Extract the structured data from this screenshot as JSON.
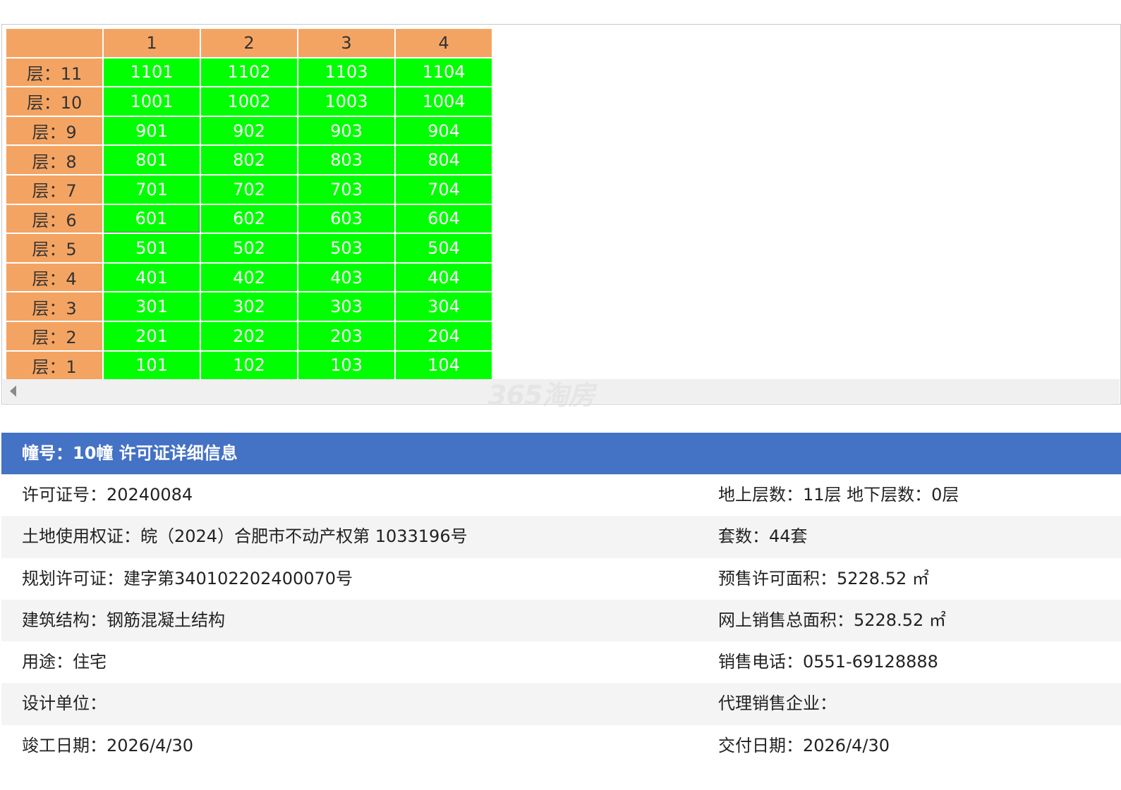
{
  "colors": {
    "header_cell": "#f4a462",
    "available_unit": "#00ff00",
    "info_header": "#4472c4",
    "alt_row": "#f4f4f5"
  },
  "table": {
    "columns": [
      "1",
      "2",
      "3",
      "4"
    ],
    "floors": [
      {
        "label": "层：11",
        "units": [
          "1101",
          "1102",
          "1103",
          "1104"
        ]
      },
      {
        "label": "层：10",
        "units": [
          "1001",
          "1002",
          "1003",
          "1004"
        ]
      },
      {
        "label": "层：9",
        "units": [
          "901",
          "902",
          "903",
          "904"
        ]
      },
      {
        "label": "层：8",
        "units": [
          "801",
          "802",
          "803",
          "804"
        ]
      },
      {
        "label": "层：7",
        "units": [
          "701",
          "702",
          "703",
          "704"
        ]
      },
      {
        "label": "层：6",
        "units": [
          "601",
          "602",
          "603",
          "604"
        ]
      },
      {
        "label": "层：5",
        "units": [
          "501",
          "502",
          "503",
          "504"
        ]
      },
      {
        "label": "层：4",
        "units": [
          "401",
          "402",
          "403",
          "404"
        ]
      },
      {
        "label": "层：3",
        "units": [
          "301",
          "302",
          "303",
          "304"
        ]
      },
      {
        "label": "层：2",
        "units": [
          "201",
          "202",
          "203",
          "204"
        ]
      },
      {
        "label": "层：1",
        "units": [
          "101",
          "102",
          "103",
          "104"
        ]
      }
    ]
  },
  "watermark": "365淘房",
  "scrollbar": {
    "icon": "scroll-left-arrow-icon"
  },
  "info": {
    "title": "幢号：10幢 许可证详细信息",
    "rows": [
      {
        "left": "许可证号：20240084",
        "right": "地上层数：11层  地下层数：0层"
      },
      {
        "left": "土地使用权证：皖（2024）合肥市不动产权第 1033196号",
        "right": "套数：44套"
      },
      {
        "left": "规划许可证：建字第340102202400070号",
        "right": "预售许可面积：5228.52 ㎡"
      },
      {
        "left": "建筑结构：钢筋混凝土结构",
        "right": "网上销售总面积：5228.52 ㎡"
      },
      {
        "left": "用途：住宅",
        "right": "销售电话：0551-69128888"
      },
      {
        "left": "设计单位：",
        "right": "代理销售企业："
      },
      {
        "left": "竣工日期：2026/4/30",
        "right": "交付日期：2026/4/30"
      }
    ]
  }
}
